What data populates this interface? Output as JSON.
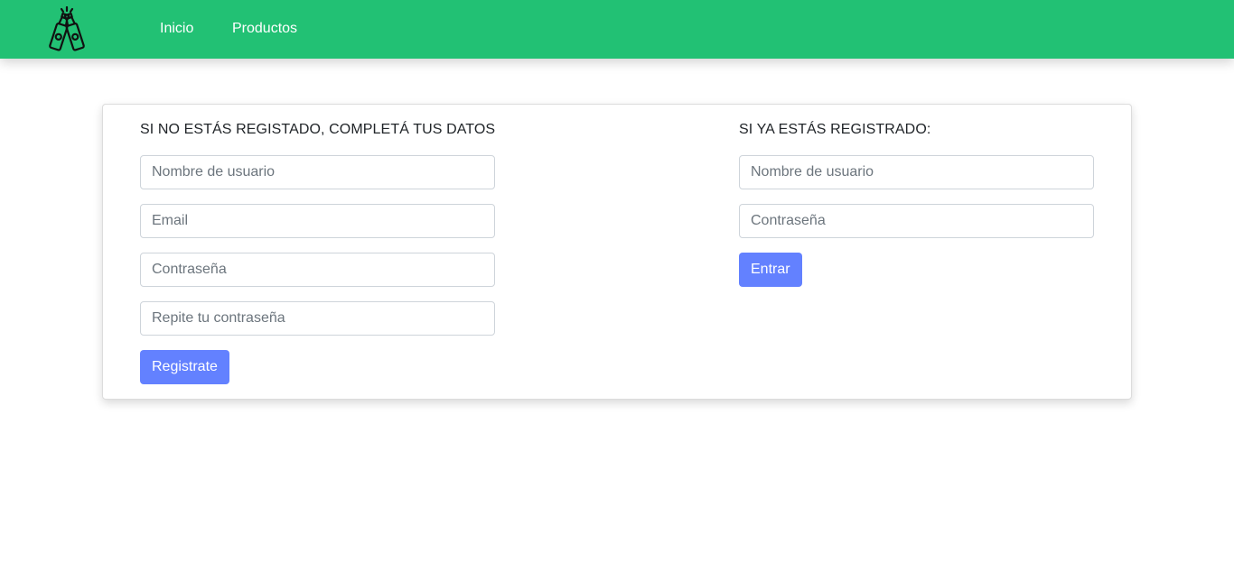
{
  "navbar": {
    "logo_icon": "beer-bottles-toast-icon",
    "links": [
      {
        "label": "Inicio"
      },
      {
        "label": "Productos"
      }
    ],
    "background_color": "#22c174"
  },
  "register": {
    "heading": "SI NO ESTÁS REGISTADO, COMPLETÁ TUS DATOS",
    "username_placeholder": "Nombre de usuario",
    "email_placeholder": "Email",
    "password_placeholder": "Contraseña",
    "repeat_password_placeholder": "Repite tu contraseña",
    "submit_label": "Registrate"
  },
  "login": {
    "heading": "SI YA ESTÁS REGISTRADO:",
    "username_placeholder": "Nombre de usuario",
    "password_placeholder": "Contraseña",
    "submit_label": "Entrar"
  },
  "colors": {
    "accent": "#6381ff",
    "brand": "#22c174"
  }
}
